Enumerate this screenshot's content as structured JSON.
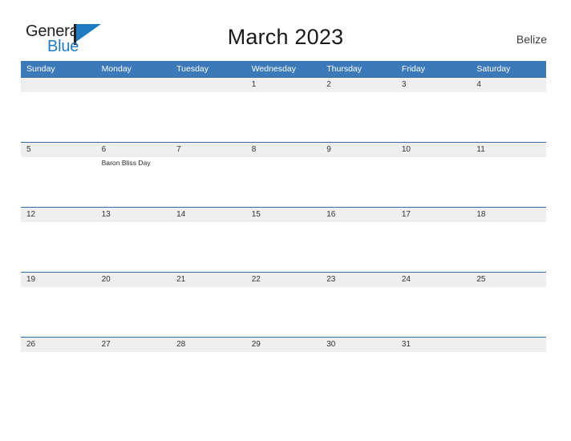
{
  "logo": {
    "word_top": "General",
    "word_bottom": "Blue",
    "flag_icon": "blue-flag-icon",
    "brand_color": "#1f7bc1"
  },
  "header": {
    "title": "March 2023",
    "country": "Belize"
  },
  "theme": {
    "header_blue": "#3b79b8",
    "date_band_gray": "#efefef",
    "row_border_blue": "#2f6da9"
  },
  "calendar": {
    "weekdays": [
      "Sunday",
      "Monday",
      "Tuesday",
      "Wednesday",
      "Thursday",
      "Friday",
      "Saturday"
    ],
    "weeks": [
      [
        {
          "day": "",
          "event": ""
        },
        {
          "day": "",
          "event": ""
        },
        {
          "day": "",
          "event": ""
        },
        {
          "day": "1",
          "event": ""
        },
        {
          "day": "2",
          "event": ""
        },
        {
          "day": "3",
          "event": ""
        },
        {
          "day": "4",
          "event": ""
        }
      ],
      [
        {
          "day": "5",
          "event": ""
        },
        {
          "day": "6",
          "event": "Baron Bliss Day"
        },
        {
          "day": "7",
          "event": ""
        },
        {
          "day": "8",
          "event": ""
        },
        {
          "day": "9",
          "event": ""
        },
        {
          "day": "10",
          "event": ""
        },
        {
          "day": "11",
          "event": ""
        }
      ],
      [
        {
          "day": "12",
          "event": ""
        },
        {
          "day": "13",
          "event": ""
        },
        {
          "day": "14",
          "event": ""
        },
        {
          "day": "15",
          "event": ""
        },
        {
          "day": "16",
          "event": ""
        },
        {
          "day": "17",
          "event": ""
        },
        {
          "day": "18",
          "event": ""
        }
      ],
      [
        {
          "day": "19",
          "event": ""
        },
        {
          "day": "20",
          "event": ""
        },
        {
          "day": "21",
          "event": ""
        },
        {
          "day": "22",
          "event": ""
        },
        {
          "day": "23",
          "event": ""
        },
        {
          "day": "24",
          "event": ""
        },
        {
          "day": "25",
          "event": ""
        }
      ],
      [
        {
          "day": "26",
          "event": ""
        },
        {
          "day": "27",
          "event": ""
        },
        {
          "day": "28",
          "event": ""
        },
        {
          "day": "29",
          "event": ""
        },
        {
          "day": "30",
          "event": ""
        },
        {
          "day": "31",
          "event": ""
        },
        {
          "day": "",
          "event": ""
        }
      ]
    ]
  }
}
